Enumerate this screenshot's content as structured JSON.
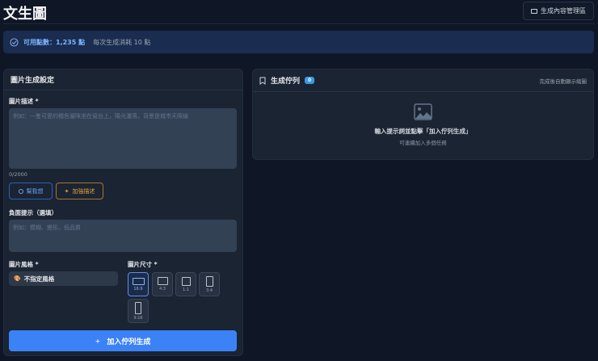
{
  "header": {
    "title": "文生圖",
    "manage_button": "生成內容管理區"
  },
  "banner": {
    "credits": "可用點數：1,235 點",
    "cost": "每次生成消耗 10 點"
  },
  "settings": {
    "title": "圖片生成設定",
    "prompt_label": "圖片描述 *",
    "prompt_placeholder": "例如：一隻可愛的橘色貓咪坐在窗台上，陽光灑落，背景是城市天際線",
    "prompt_value": "",
    "char_count": "0/2000",
    "inspire_button": "幫我想",
    "enhance_button": "加強描述",
    "negative_label": "負面提示（選填）",
    "negative_placeholder": "例如：模糊、變形、低品質",
    "style_label": "圖片風格 *",
    "style_value": "不指定風格",
    "size_label": "圖片尺寸 *",
    "sizes": [
      "16:9",
      "4:3",
      "1:1",
      "3:4",
      "9:16"
    ],
    "selected_size": "16:9",
    "submit_button": "加入佇列生成"
  },
  "queue": {
    "title": "生成佇列",
    "count": "0",
    "hint": "完成後自動顯示縮圖",
    "empty_title": "輸入提示詞並點擊「加入佇列生成」",
    "empty_sub": "可連續加入多個任務"
  },
  "colors": {
    "accent": "#3b82f6",
    "enhance": "#d99a2b",
    "badge": "#3b9ae6"
  }
}
